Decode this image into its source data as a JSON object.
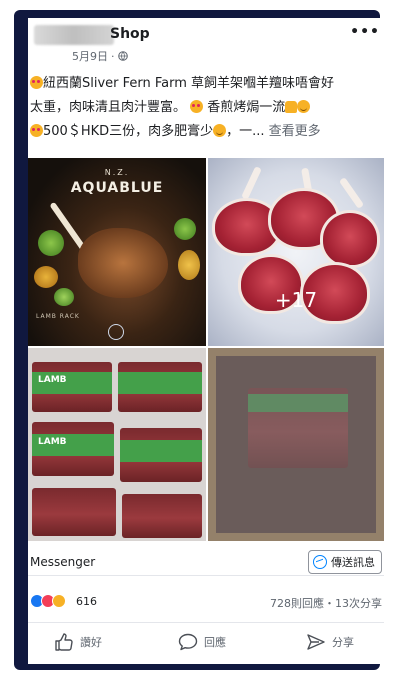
{
  "post": {
    "page_name": "Shop",
    "date": "5月9日",
    "more_label": "•••",
    "text_lines": [
      "紐西蘭Sliver Fern Farm 草飼羊架嗰羊羶味唔會好",
      "太重，肉味清且肉汁豐富。",
      "香煎烤焗一流",
      "500＄HKD三份，肉多肥膏少",
      "，一...",
      "查看更多"
    ]
  },
  "photos": {
    "photo1": {
      "line1": "N.Z.",
      "line2": "AQUABLUE",
      "caption": "LAMB RACK"
    },
    "photo3": {
      "pack_label": "LAMB"
    },
    "more_count": "+17"
  },
  "messenger": {
    "label": "Messenger",
    "send_button": "傳送訊息"
  },
  "stats": {
    "reactions_count": "616",
    "comments_shares": "728則回應・13次分享"
  },
  "actions": {
    "like": "讚好",
    "comment": "回應",
    "share": "分享"
  },
  "colors": {
    "accent": "#1877f2",
    "love": "#f33e58",
    "wow": "#f7b125",
    "frame": "#10183f",
    "pack_band": "#44a04a"
  },
  "icons": [
    "globe-icon",
    "more-icon",
    "messenger-icon",
    "like-icon",
    "comment-icon",
    "share-icon"
  ]
}
